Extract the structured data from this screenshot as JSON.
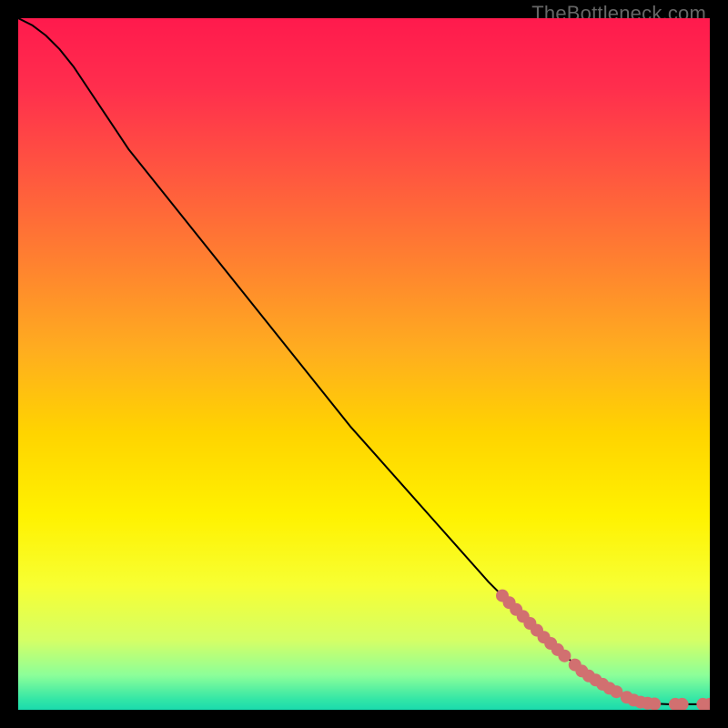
{
  "watermark": "TheBottleneck.com",
  "chart_data": {
    "type": "line",
    "title": "",
    "xlabel": "",
    "ylabel": "",
    "xlim": [
      0,
      100
    ],
    "ylim": [
      0,
      100
    ],
    "curve": {
      "name": "bottleneck-curve",
      "x": [
        0,
        2,
        4,
        6,
        8,
        10,
        12,
        14,
        16,
        18,
        20,
        24,
        28,
        32,
        36,
        40,
        44,
        48,
        52,
        56,
        60,
        64,
        68,
        72,
        76,
        80,
        84,
        88,
        90,
        92,
        94,
        96,
        98,
        100
      ],
      "y": [
        100,
        99,
        97.5,
        95.5,
        93,
        90,
        87,
        84,
        81,
        78.5,
        76,
        71,
        66,
        61,
        56,
        51,
        46,
        41,
        36.5,
        32,
        27.5,
        23,
        18.5,
        14.5,
        10.5,
        7,
        4,
        1.8,
        1.2,
        0.9,
        0.8,
        0.8,
        0.8,
        0.8
      ]
    },
    "markers": {
      "color": "#d17070",
      "points": [
        {
          "x": 70,
          "y": 16.5
        },
        {
          "x": 71,
          "y": 15.5
        },
        {
          "x": 72,
          "y": 14.5
        },
        {
          "x": 73,
          "y": 13.5
        },
        {
          "x": 74,
          "y": 12.5
        },
        {
          "x": 75,
          "y": 11.5
        },
        {
          "x": 76,
          "y": 10.5
        },
        {
          "x": 77,
          "y": 9.6
        },
        {
          "x": 78,
          "y": 8.7
        },
        {
          "x": 79,
          "y": 7.8
        },
        {
          "x": 80.5,
          "y": 6.5
        },
        {
          "x": 81.5,
          "y": 5.6
        },
        {
          "x": 82.5,
          "y": 4.9
        },
        {
          "x": 83.5,
          "y": 4.3
        },
        {
          "x": 84.5,
          "y": 3.7
        },
        {
          "x": 85.5,
          "y": 3.1
        },
        {
          "x": 86.5,
          "y": 2.6
        },
        {
          "x": 88,
          "y": 1.8
        },
        {
          "x": 89,
          "y": 1.4
        },
        {
          "x": 90,
          "y": 1.1
        },
        {
          "x": 91,
          "y": 0.95
        },
        {
          "x": 92,
          "y": 0.85
        },
        {
          "x": 95,
          "y": 0.8
        },
        {
          "x": 96,
          "y": 0.8
        },
        {
          "x": 99,
          "y": 0.8
        },
        {
          "x": 100,
          "y": 0.8
        }
      ]
    },
    "gradient_stops": [
      {
        "offset": 0.0,
        "color": "#ff1a4d"
      },
      {
        "offset": 0.1,
        "color": "#ff2e4d"
      },
      {
        "offset": 0.22,
        "color": "#ff5540"
      },
      {
        "offset": 0.35,
        "color": "#ff8030"
      },
      {
        "offset": 0.48,
        "color": "#ffad1f"
      },
      {
        "offset": 0.6,
        "color": "#ffd400"
      },
      {
        "offset": 0.72,
        "color": "#fff200"
      },
      {
        "offset": 0.82,
        "color": "#f7ff33"
      },
      {
        "offset": 0.9,
        "color": "#d4ff66"
      },
      {
        "offset": 0.95,
        "color": "#8cff99"
      },
      {
        "offset": 0.985,
        "color": "#33e6a6"
      },
      {
        "offset": 1.0,
        "color": "#1adbad"
      }
    ]
  }
}
